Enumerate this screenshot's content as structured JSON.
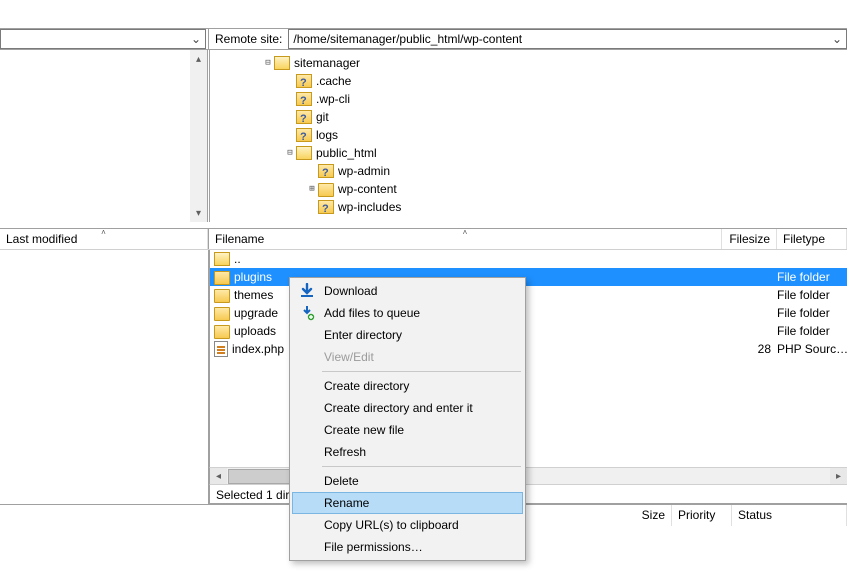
{
  "remote": {
    "site_label": "Remote site:",
    "path": "/home/sitemanager/public_html/wp-content"
  },
  "tree": {
    "items": [
      {
        "level": 2,
        "expander": "minus",
        "icon": "folder-open",
        "label": "sitemanager"
      },
      {
        "level": 3,
        "expander": "",
        "icon": "folder-q",
        "label": ".cache"
      },
      {
        "level": 3,
        "expander": "",
        "icon": "folder-q",
        "label": ".wp-cli"
      },
      {
        "level": 3,
        "expander": "",
        "icon": "folder-q",
        "label": "git"
      },
      {
        "level": 3,
        "expander": "",
        "icon": "folder-q",
        "label": "logs"
      },
      {
        "level": 3,
        "expander": "minus",
        "icon": "folder-open",
        "label": "public_html"
      },
      {
        "level": 4,
        "expander": "",
        "icon": "folder-q",
        "label": "wp-admin"
      },
      {
        "level": 4,
        "expander": "plus",
        "icon": "folder",
        "label": "wp-content"
      },
      {
        "level": 4,
        "expander": "",
        "icon": "folder-q",
        "label": "wp-includes"
      }
    ]
  },
  "local_header": {
    "col_lastmod": "Last modified"
  },
  "remote_header": {
    "col_filename": "Filename",
    "col_filesize": "Filesize",
    "col_filetype": "Filetype"
  },
  "files": [
    {
      "icon": "folder-open",
      "name": "..",
      "size": "",
      "type": "",
      "selected": false
    },
    {
      "icon": "folder",
      "name": "plugins",
      "size": "",
      "type": "File folder",
      "selected": true
    },
    {
      "icon": "folder",
      "name": "themes",
      "size": "",
      "type": "File folder",
      "selected": false
    },
    {
      "icon": "folder",
      "name": "upgrade",
      "size": "",
      "type": "File folder",
      "selected": false
    },
    {
      "icon": "folder",
      "name": "uploads",
      "size": "",
      "type": "File folder",
      "selected": false
    },
    {
      "icon": "php",
      "name": "index.php",
      "size": "28",
      "type": "PHP Sourc…",
      "selected": false
    }
  ],
  "status": {
    "text": "Selected 1 dire"
  },
  "queue_header": {
    "size": "Size",
    "priority": "Priority",
    "status": "Status"
  },
  "context_menu": {
    "download": "Download",
    "add_queue": "Add files to queue",
    "enter_dir": "Enter directory",
    "viewedit": "View/Edit",
    "create_dir": "Create directory",
    "create_dir_enter": "Create directory and enter it",
    "create_file": "Create new file",
    "refresh": "Refresh",
    "delete": "Delete",
    "rename": "Rename",
    "copy_urls": "Copy URL(s) to clipboard",
    "file_perms": "File permissions…"
  }
}
